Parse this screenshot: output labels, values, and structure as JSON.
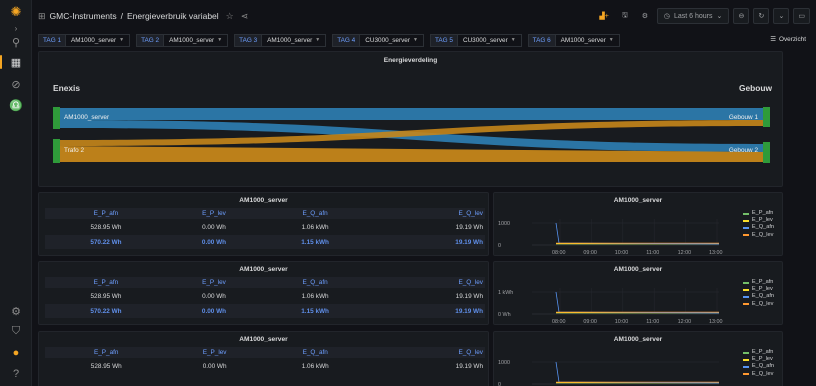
{
  "breadcrumb": {
    "folder": "GMC-Instruments",
    "separator": "/",
    "dashboard": "Energieverbruik variabel"
  },
  "toolbar": {
    "time_range": "Last 6 hours"
  },
  "variables": [
    {
      "label": "TAG 1",
      "value": "AM1000_server"
    },
    {
      "label": "TAG 2",
      "value": "AM1000_server"
    },
    {
      "label": "TAG 3",
      "value": "AM1000_server"
    },
    {
      "label": "TAG 4",
      "value": "CU3000_server"
    },
    {
      "label": "TAG 5",
      "value": "CU3000_server"
    },
    {
      "label": "TAG 6",
      "value": "AM1000_server"
    }
  ],
  "overzicht_label": "Overzicht",
  "sankey": {
    "title": "Energieverdeling",
    "left_header": "Enexis",
    "right_header": "Gebouw",
    "sources": [
      "AM1000_server",
      "Trafo 2"
    ],
    "targets": [
      "Gebouw 1",
      "Gebouw 2"
    ],
    "colors": {
      "source_1": "#2e7fb4",
      "source_2": "#c5861a",
      "node": "#2f9b3a"
    }
  },
  "tables": [
    {
      "title": "AM1000_server",
      "headers": [
        "E_P_afn",
        "E_P_lev",
        "E_Q_afn",
        "E_Q_lev"
      ],
      "row": [
        "528.95 Wh",
        "0.00 Wh",
        "1.06 kWh",
        "19.19 Wh"
      ],
      "total": [
        "570.22 Wh",
        "0.00 Wh",
        "1.15 kWh",
        "19.19 Wh"
      ]
    },
    {
      "title": "AM1000_server",
      "headers": [
        "E_P_afn",
        "E_P_lev",
        "E_Q_afn",
        "E_Q_lev"
      ],
      "row": [
        "528.95 Wh",
        "0.00 Wh",
        "1.06 kWh",
        "19.19 Wh"
      ],
      "total": [
        "570.22 Wh",
        "0.00 Wh",
        "1.15 kWh",
        "19.19 Wh"
      ]
    },
    {
      "title": "AM1000_server",
      "headers": [
        "E_P_afn",
        "E_P_lev",
        "E_Q_afn",
        "E_Q_lev"
      ],
      "row": [
        "528.95 Wh",
        "0.00 Wh",
        "1.06 kWh",
        "19.19 Wh"
      ]
    }
  ],
  "chart_data": [
    {
      "type": "line",
      "title": "AM1000_server",
      "x": [
        "08:00",
        "09:00",
        "10:00",
        "11:00",
        "12:00",
        "13:00"
      ],
      "yticks": [
        "1000",
        "0"
      ],
      "series": [
        {
          "name": "E_P_afn",
          "color": "#73bf69"
        },
        {
          "name": "E_P_lev",
          "color": "#fade2a"
        },
        {
          "name": "E_Q_afn",
          "color": "#5794f2"
        },
        {
          "name": "E_Q_lev",
          "color": "#ff9830"
        }
      ]
    },
    {
      "type": "line",
      "title": "AM1000_server",
      "x": [
        "08:00",
        "09:00",
        "10:00",
        "11:00",
        "12:00",
        "13:00"
      ],
      "yticks": [
        "1 kWh",
        "0 Wh"
      ],
      "series": [
        {
          "name": "E_P_afn",
          "color": "#73bf69"
        },
        {
          "name": "E_P_lev",
          "color": "#fade2a"
        },
        {
          "name": "E_Q_afn",
          "color": "#5794f2"
        },
        {
          "name": "E_Q_lev",
          "color": "#ff9830"
        }
      ]
    },
    {
      "type": "line",
      "title": "AM1000_server",
      "yticks": [
        "1000",
        "0"
      ],
      "series": [
        {
          "name": "E_P_afn",
          "color": "#73bf69"
        },
        {
          "name": "E_P_lev",
          "color": "#fade2a"
        },
        {
          "name": "E_Q_afn",
          "color": "#5794f2"
        },
        {
          "name": "E_Q_lev",
          "color": "#ff9830"
        }
      ]
    }
  ]
}
